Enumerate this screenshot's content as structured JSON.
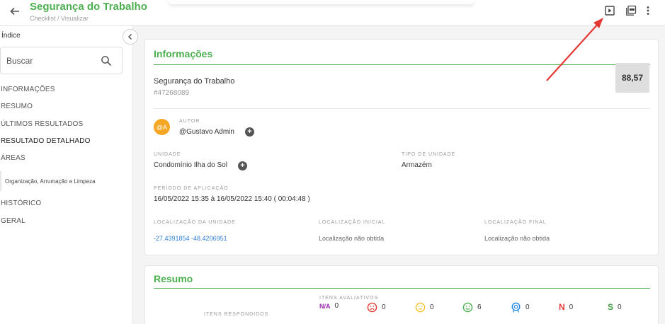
{
  "header": {
    "title": "Segurança do Trabalho",
    "breadcrumb": "Checklist / Visualizar"
  },
  "sidebar": {
    "index_label": "Índice",
    "search_placeholder": "Buscar",
    "items": [
      {
        "label": "INFORMAÇÕES"
      },
      {
        "label": "RESUMO"
      },
      {
        "label": "ÚLTIMOS RESULTADOS"
      },
      {
        "label": "RESULTADO DETALHADO"
      },
      {
        "label": "ÁREAS"
      },
      {
        "label": "Organização, Arrumação e Limpeza"
      },
      {
        "label": "HISTÓRICO"
      },
      {
        "label": "GERAL"
      }
    ]
  },
  "info": {
    "title": "Informações",
    "checklist_name": "Segurança do Trabalho",
    "checklist_id": "#47268089",
    "score": "88,57",
    "avatar_text": "@A",
    "author_label": "AUTOR",
    "author_value": "@Gustavo Admin",
    "unit_label": "UNIDADE",
    "unit_value": "Condomínio Ilha do Sol",
    "unit_type_label": "TIPO DE UNIDADE",
    "unit_type_value": "Armazém",
    "period_label": "PERÍODO DE APLICAÇÃO",
    "period_value": "16/05/2022 15:35 à 16/05/2022 15:40 ( 00:04:48 )",
    "unit_location_label": "LOCALIZAÇÃO DA UNIDADE",
    "unit_location_value": "-27.4391854 -48.4206951",
    "initial_location_label": "LOCALIZAÇÃO INICIAL",
    "initial_location_value": "Localização não obtida",
    "final_location_label": "LOCALIZAÇÃO FINAL",
    "final_location_value": "Localização não obtida"
  },
  "summary": {
    "title": "Resumo",
    "answered_label": "ITENS RESPONDIDOS",
    "evaluative_label": "ITENS AVALIATIVOS",
    "items": [
      {
        "glyph": "N/A",
        "count": "0",
        "color": "#9c27b0",
        "icon": "na-icon"
      },
      {
        "glyph": "☹",
        "count": "0",
        "color": "#e53935",
        "icon": "sad-face-icon"
      },
      {
        "glyph": "☺",
        "count": "0",
        "color": "#fbc02d",
        "icon": "neutral-face-icon"
      },
      {
        "glyph": "☺",
        "count": "6",
        "color": "#4caf50",
        "icon": "happy-face-icon"
      },
      {
        "glyph": "✿",
        "count": "0",
        "color": "#1e88e5",
        "icon": "badge-icon"
      },
      {
        "glyph": "N",
        "count": "0",
        "color": "#e53935",
        "icon": "no-icon"
      },
      {
        "glyph": "S",
        "count": "0",
        "color": "#43a047",
        "icon": "yes-icon"
      }
    ]
  },
  "colors": {
    "brand_green": "#4caf50",
    "arrow_red": "#e53935"
  }
}
